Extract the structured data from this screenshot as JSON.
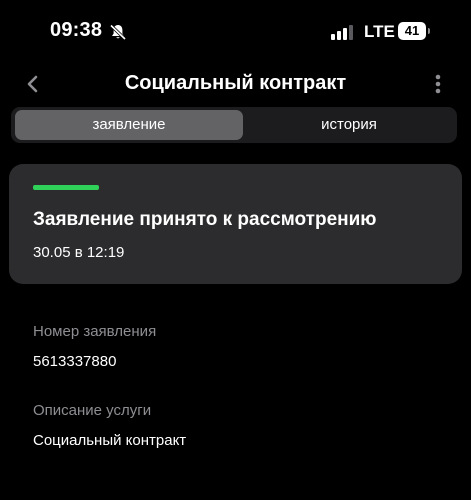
{
  "status_bar": {
    "time": "09:38",
    "network": "LTE",
    "battery": "41",
    "icons": [
      "bell-slash-icon",
      "signal-icon",
      "battery-icon"
    ]
  },
  "nav": {
    "title": "Социальный контракт",
    "back_icon": "chevron-left-icon",
    "more_icon": "more-vertical-icon"
  },
  "tabs": [
    {
      "label": "заявление",
      "active": true
    },
    {
      "label": "история",
      "active": false
    }
  ],
  "status_card": {
    "title": "Заявление принято к рассмотрению",
    "date": "30.05 в 12:19",
    "indicator_color": "#30d158"
  },
  "details": [
    {
      "label": "Номер заявления",
      "value": "5613337880"
    },
    {
      "label": "Описание услуги",
      "value": "Социальный контракт"
    }
  ]
}
